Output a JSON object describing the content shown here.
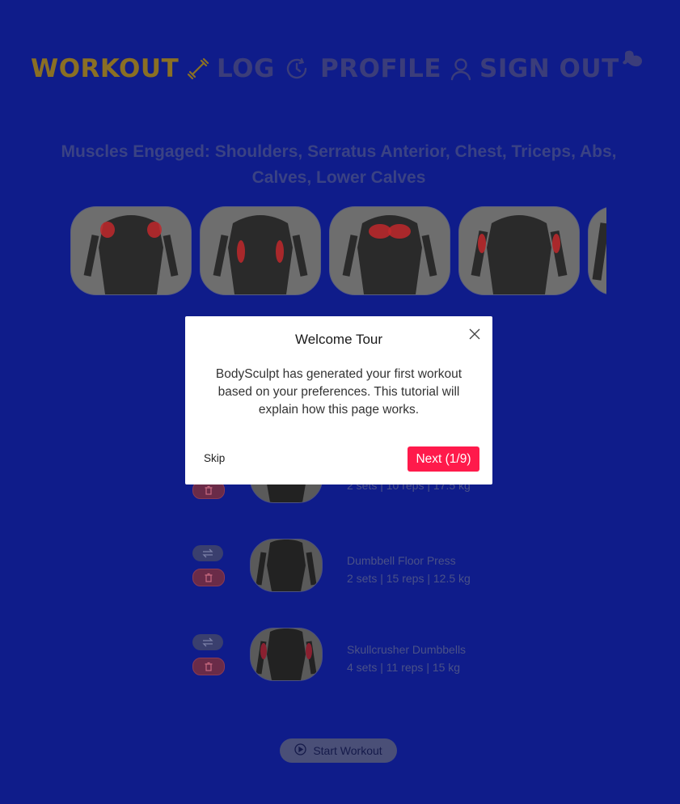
{
  "nav": {
    "workout": "WORKOUT",
    "log": "LOG",
    "profile": "PROFILE",
    "sign_out": "SIGN OUT",
    "icons": [
      "dumbbell-icon",
      "history-clock-icon",
      "user-icon",
      "flexed-arm-logo-icon"
    ]
  },
  "muscles": {
    "title": "Muscles Engaged: Shoulders, Serratus Anterior, Chest, Triceps, Abs, Calves, Lower Calves"
  },
  "exercises": [
    {
      "name": "",
      "sets": "2 sets | 10 reps | 17.5 kg"
    },
    {
      "name": "Dumbbell Floor Press",
      "sets": "2 sets | 15 reps | 12.5 kg"
    },
    {
      "name": "Skullcrusher Dumbbells",
      "sets": "4 sets | 11 reps | 15 kg"
    }
  ],
  "start_button": {
    "label": "Start Workout"
  },
  "modal": {
    "title": "Welcome Tour",
    "body": "BodySculpt has generated your first workout based on your preferences. This tutorial will explain how this page works.",
    "skip": "Skip",
    "next": "Next (1/9)"
  },
  "colors": {
    "background": "#0f1c8a",
    "active_nav": "#8a6f24",
    "accent_next": "#ff1a4b",
    "muscle_highlight": "#c0282b"
  }
}
